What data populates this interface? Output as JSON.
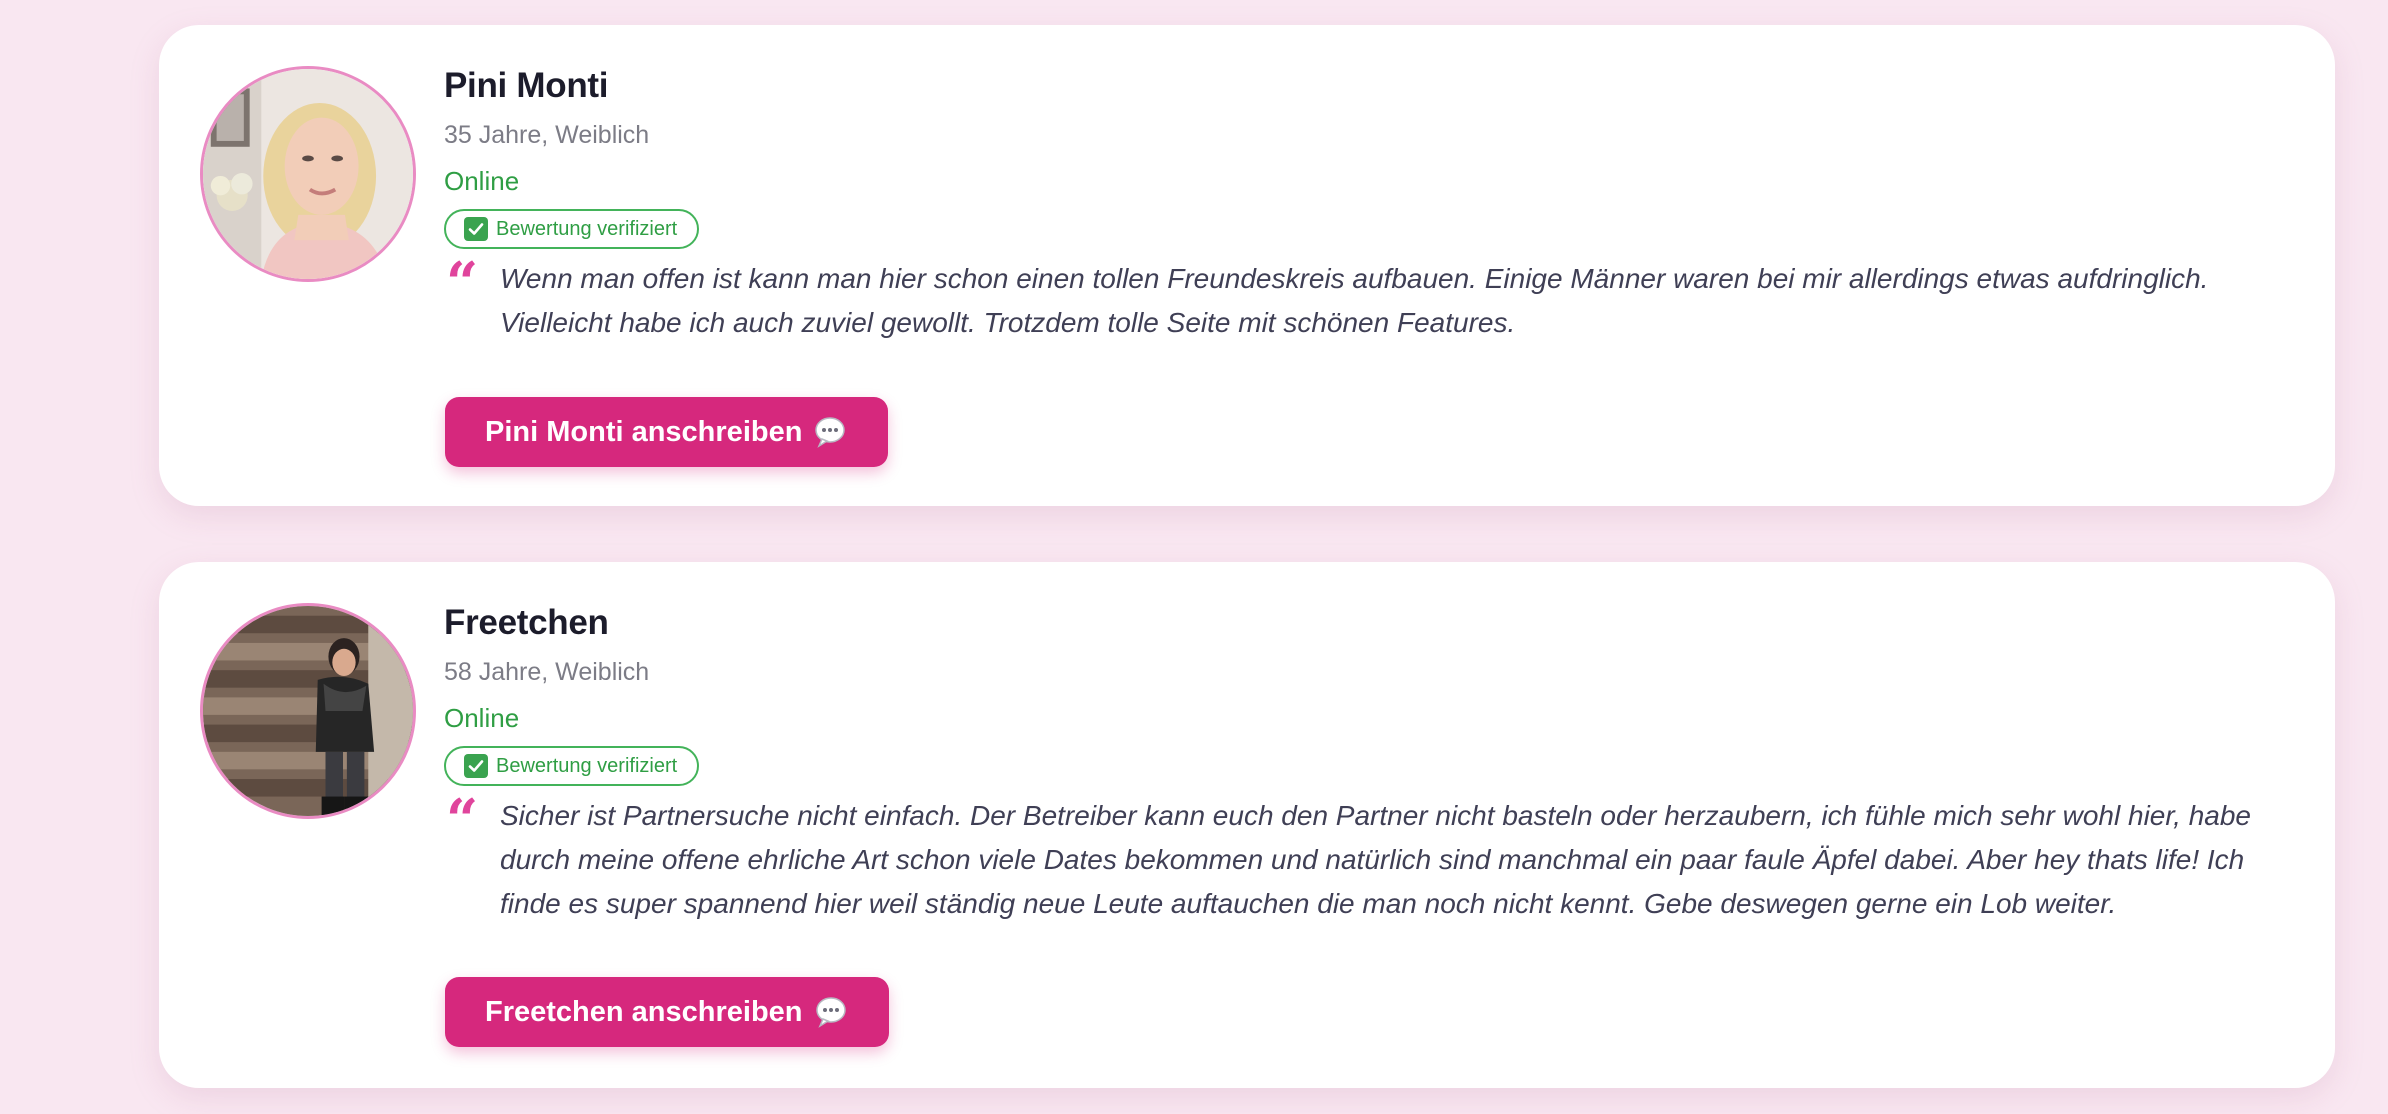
{
  "reviews": [
    {
      "name": "Pini Monti",
      "meta": "35 Jahre, Weiblich",
      "status": "Online",
      "badge": "Bewertung verifiziert",
      "quote": "Wenn man offen ist kann man hier schon einen tollen Freundeskreis aufbauen. Einige Männer waren bei mir allerdings etwas aufdringlich. Vielleicht habe ich auch zuviel gewollt. Trotzdem tolle Seite mit schönen Features.",
      "button": "Pini Monti anschreiben",
      "icon_avatar": "profile-photo",
      "icon_badge": "check-icon",
      "icon_button": "speech-bubble-icon"
    },
    {
      "name": "Freetchen",
      "meta": "58 Jahre, Weiblich",
      "status": "Online",
      "badge": "Bewertung verifiziert",
      "quote": "Sicher ist Partnersuche nicht einfach. Der Betreiber kann euch den Partner nicht basteln oder herzaubern, ich fühle mich sehr wohl hier, habe durch meine offene ehrliche Art schon viele Dates bekommen und natürlich sind manchmal ein paar faule Äpfel dabei. Aber hey thats life! Ich finde es super spannend hier weil ständig neue Leute auftauchen die man noch nicht kennt. Gebe deswegen gerne ein Lob weiter.",
      "button": "Freetchen anschreiben",
      "icon_avatar": "profile-photo",
      "icon_badge": "check-icon",
      "icon_button": "speech-bubble-icon"
    }
  ],
  "colors": {
    "page_background": "#f9e7f1",
    "card_background": "#ffffff",
    "accent_pink": "#d6287d",
    "quote_mark": "#e0449c",
    "online_green": "#2f9e44",
    "avatar_border": "#e98bc3",
    "name_text": "#1c1c2b",
    "meta_text": "#7c7c86",
    "quote_text": "#3f3f55"
  }
}
